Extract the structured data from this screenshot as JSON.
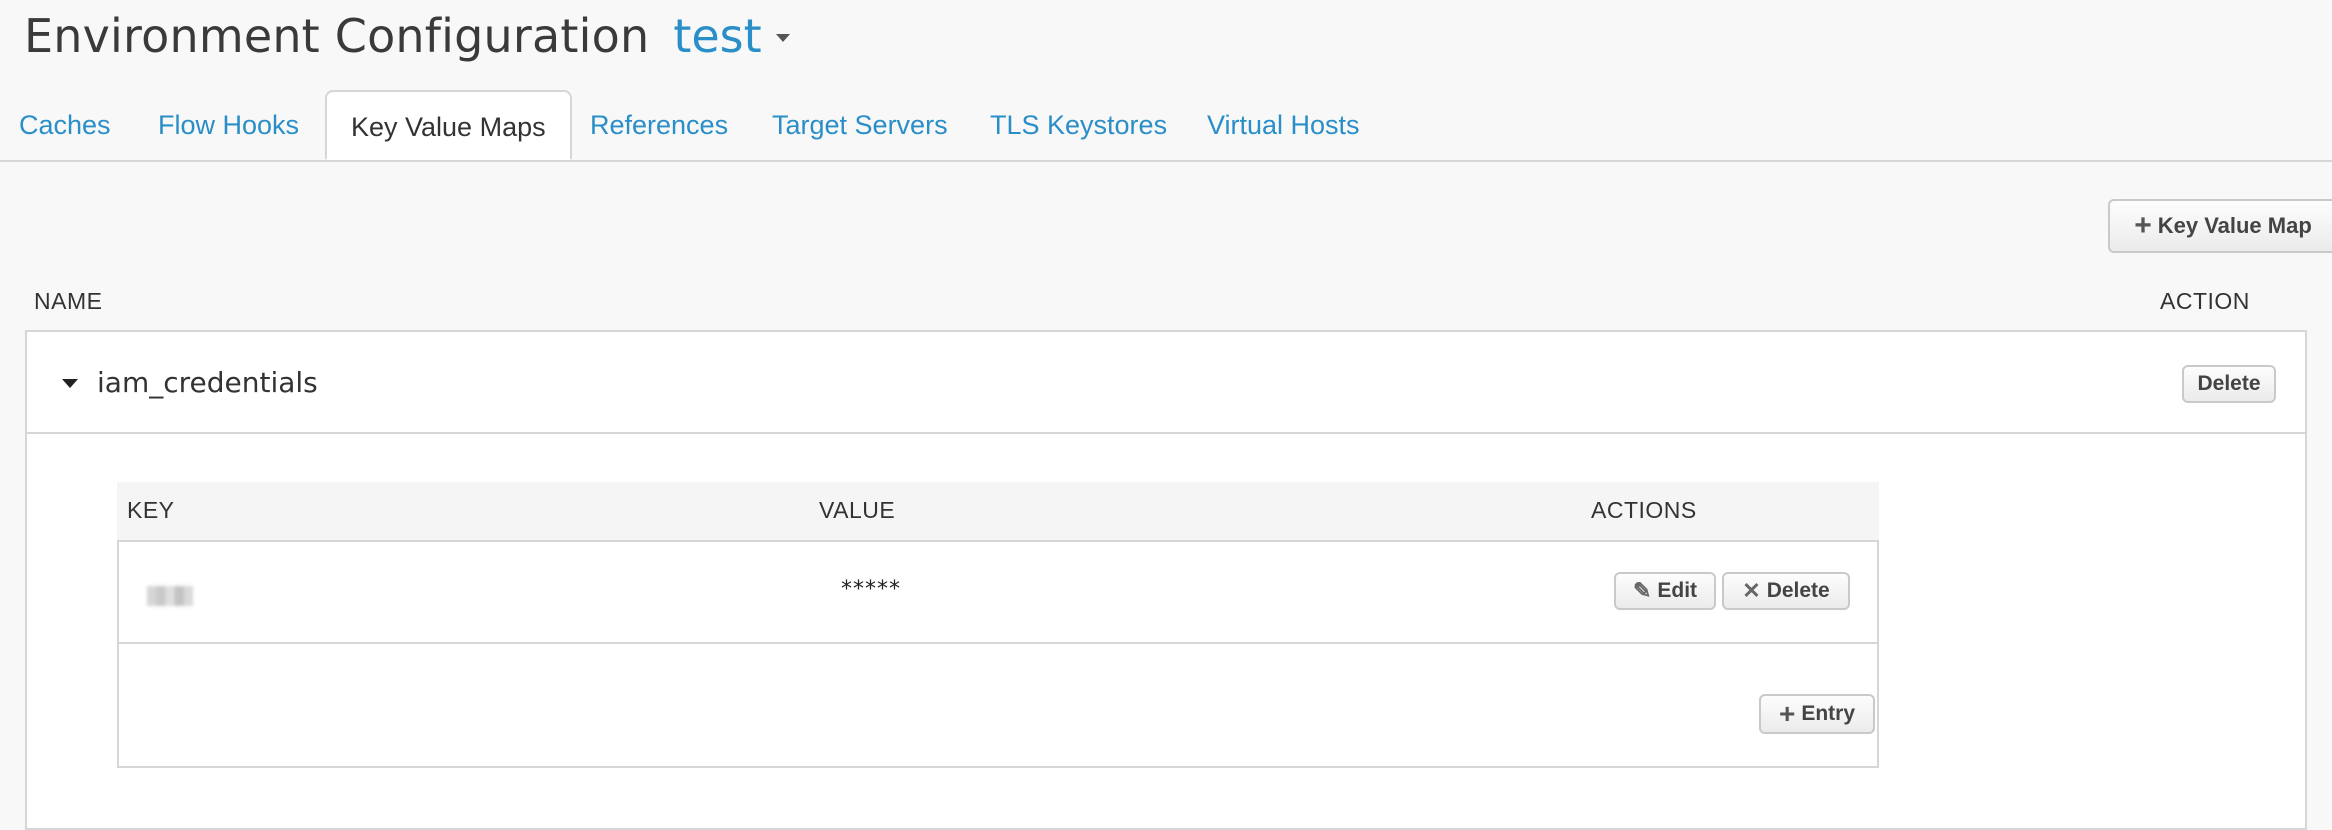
{
  "header": {
    "title": "Environment Configuration",
    "environment": "test"
  },
  "tabs": [
    {
      "label": "Caches",
      "active": false
    },
    {
      "label": "Flow Hooks",
      "active": false
    },
    {
      "label": "Key Value Maps",
      "active": true
    },
    {
      "label": "References",
      "active": false
    },
    {
      "label": "Target Servers",
      "active": false
    },
    {
      "label": "TLS Keystores",
      "active": false
    },
    {
      "label": "Virtual Hosts",
      "active": false
    }
  ],
  "toolbar": {
    "add_kvm_label": "Key Value Map"
  },
  "kvm_table": {
    "name_header": "NAME",
    "action_header": "ACTION",
    "rows": [
      {
        "name": "iam_credentials",
        "delete_label": "Delete",
        "expanded": true,
        "entries_table": {
          "key_header": "KEY",
          "value_header": "VALUE",
          "actions_header": "ACTIONS",
          "entries": [
            {
              "key": "",
              "value": "*****",
              "edit_label": "Edit",
              "delete_label": "Delete"
            }
          ],
          "add_entry_label": "Entry"
        }
      }
    ]
  },
  "colors": {
    "link": "#2a8ec8",
    "border": "#d6d6d6",
    "background": "#f7f8f7"
  }
}
